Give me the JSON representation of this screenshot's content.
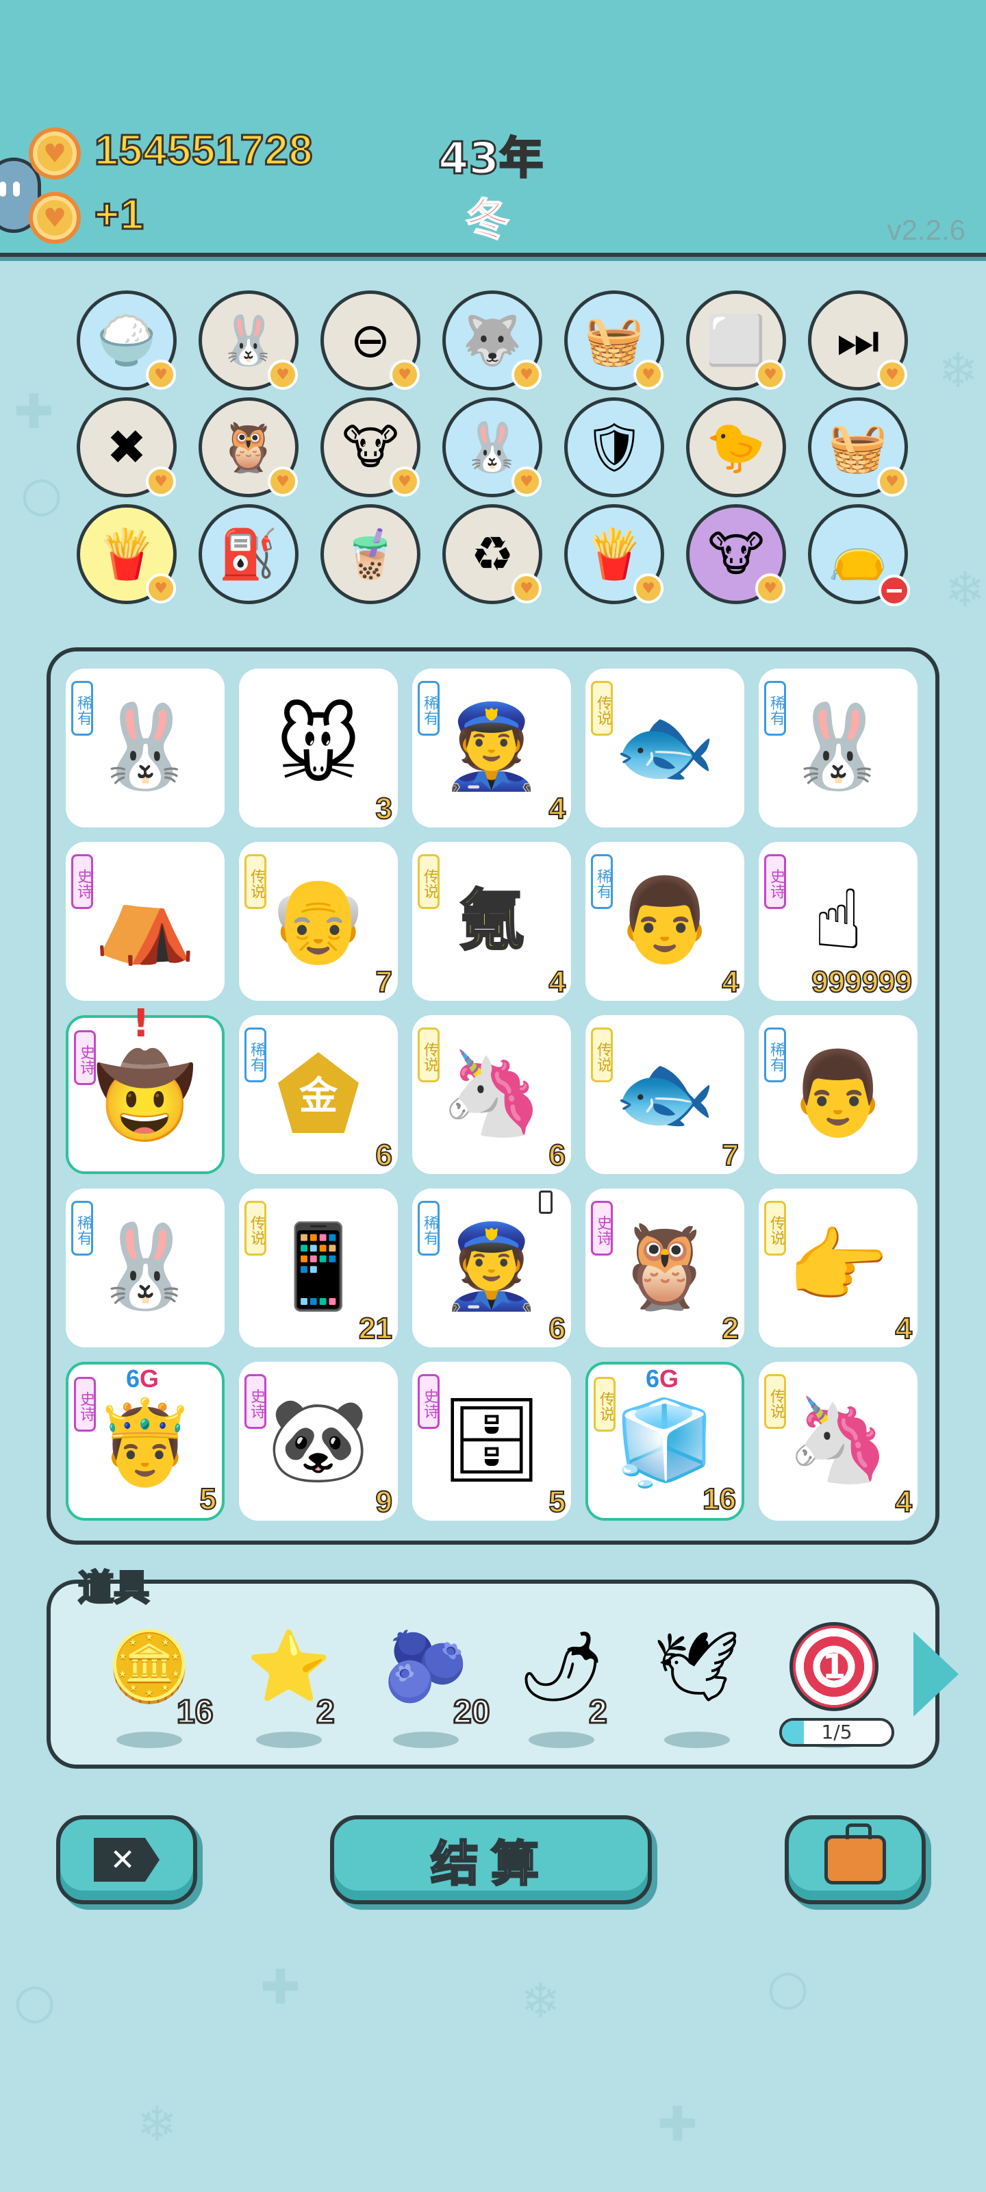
{
  "header": {
    "coins": "154551728",
    "coin_gain": "+1",
    "year": "43年",
    "season": "冬",
    "version": "v2.2.6"
  },
  "skills": [
    {
      "icon": "rice-bowl",
      "bg": "#bfe7f7",
      "badge": "heart"
    },
    {
      "icon": "rabbit",
      "bg": "#e9e4da",
      "badge": "heart"
    },
    {
      "icon": "minus-circle",
      "bg": "#e9e4da",
      "badge": "heart"
    },
    {
      "icon": "husky-dog",
      "bg": "#bfe7f7",
      "badge": "heart"
    },
    {
      "icon": "fruit-basket",
      "bg": "#bfe7f7",
      "badge": "heart"
    },
    {
      "icon": "cubes",
      "bg": "#e9e4da",
      "badge": "heart"
    },
    {
      "icon": "skip-next",
      "bg": "#e9e4da",
      "badge": "heart"
    },
    {
      "icon": "delete-tag",
      "bg": "#e9e4da",
      "badge": "heart"
    },
    {
      "icon": "owls",
      "bg": "#e9e4da",
      "badge": "heart"
    },
    {
      "icon": "cow-pair",
      "bg": "#e9e4da",
      "badge": "heart"
    },
    {
      "icon": "rabbit",
      "bg": "#bfe7f7",
      "badge": "heart"
    },
    {
      "icon": "shield-wrench",
      "bg": "#bfe7f7",
      "badge": "none"
    },
    {
      "icon": "chick-egg",
      "bg": "#e9e4da",
      "badge": "none"
    },
    {
      "icon": "fruit-basket",
      "bg": "#bfe7f7",
      "badge": "heart"
    },
    {
      "icon": "fries",
      "bg": "#fdf59a",
      "badge": "heart"
    },
    {
      "icon": "pump",
      "bg": "#bfe7f7",
      "badge": "none"
    },
    {
      "icon": "bubble-tea",
      "bg": "#e9e4da",
      "badge": "none"
    },
    {
      "icon": "recycle",
      "bg": "#e9e4da",
      "badge": "heart"
    },
    {
      "icon": "fries",
      "bg": "#bfe7f7",
      "badge": "heart"
    },
    {
      "icon": "cow-pair",
      "bg": "#c9a2e6",
      "badge": "heart"
    },
    {
      "icon": "sack",
      "bg": "#bfe7f7",
      "badge": "minus"
    }
  ],
  "board": [
    {
      "tag": "稀有",
      "rarity": "rare",
      "icon": "rabbit",
      "count": ""
    },
    {
      "tag": "",
      "rarity": "",
      "icon": "mouse",
      "count": "3"
    },
    {
      "tag": "稀有",
      "rarity": "rare",
      "icon": "police-officer",
      "count": "4"
    },
    {
      "tag": "传说",
      "rarity": "legend",
      "icon": "koi-fish",
      "count": ""
    },
    {
      "tag": "稀有",
      "rarity": "rare",
      "icon": "rabbit",
      "count": ""
    },
    {
      "tag": "史诗",
      "rarity": "epic",
      "icon": "rabbit-tent",
      "count": ""
    },
    {
      "tag": "传说",
      "rarity": "legend",
      "icon": "grinning-old-man",
      "count": "7"
    },
    {
      "tag": "传说",
      "rarity": "legend",
      "icon": "krypton-text",
      "text": "氪",
      "count": "4"
    },
    {
      "tag": "稀有",
      "rarity": "rare",
      "icon": "bald-man",
      "count": "4"
    },
    {
      "tag": "史诗",
      "rarity": "epic",
      "icon": "pointing-hand",
      "count": "999999"
    },
    {
      "tag": "史诗",
      "rarity": "epic",
      "icon": "cowboy-grandpa",
      "count": "",
      "highlight": true
    },
    {
      "tag": "稀有",
      "rarity": "rare",
      "icon": "gold-pentagon",
      "text": "金",
      "count": "6"
    },
    {
      "tag": "传说",
      "rarity": "legend",
      "icon": "unicorn",
      "count": "6"
    },
    {
      "tag": "传说",
      "rarity": "legend",
      "icon": "koi-fish",
      "count": "7"
    },
    {
      "tag": "稀有",
      "rarity": "rare",
      "icon": "bald-man",
      "count": ""
    },
    {
      "tag": "稀有",
      "rarity": "rare",
      "icon": "rabbit",
      "count": ""
    },
    {
      "tag": "传说",
      "rarity": "legend",
      "icon": "smartphone",
      "count": "21"
    },
    {
      "tag": "稀有",
      "rarity": "rare",
      "icon": "police-officer",
      "count": "6"
    },
    {
      "tag": "史诗",
      "rarity": "epic",
      "icon": "gray-hair-bird",
      "count": "2"
    },
    {
      "tag": "传说",
      "rarity": "legend",
      "icon": "golden-hand",
      "count": "4"
    },
    {
      "tag": "史诗",
      "rarity": "epic",
      "icon": "king-grandpa",
      "count": "5",
      "highlight": true,
      "sixg": "6G"
    },
    {
      "tag": "史诗",
      "rarity": "epic",
      "icon": "panda",
      "count": "9"
    },
    {
      "tag": "史诗",
      "rarity": "epic",
      "icon": "server-rack",
      "count": "5"
    },
    {
      "tag": "传说",
      "rarity": "legend",
      "icon": "fridge",
      "count": "16",
      "highlight": true,
      "sixg": "6G"
    },
    {
      "tag": "传说",
      "rarity": "legend",
      "icon": "unicorn",
      "count": "4"
    }
  ],
  "alert_mark": "!",
  "props": {
    "label": "道具",
    "items": [
      {
        "icon": "dollar-coin",
        "count": "16"
      },
      {
        "icon": "star",
        "count": "2"
      },
      {
        "icon": "blueberry",
        "count": "20"
      },
      {
        "icon": "chili-pepper",
        "count": "2"
      },
      {
        "icon": "pigeon",
        "count": ""
      },
      {
        "icon": "target-1",
        "count": ""
      }
    ],
    "target_digit": "1",
    "progress_text": "1/5",
    "progress_fraction": 0.2
  },
  "buttons": {
    "delete_label": "✕",
    "settle_label": "结算"
  },
  "colors": {
    "header_bg": "#6ec9cc",
    "page_bg": "#b6dfe6",
    "gold_text": "#ffd33d",
    "rare": "#3d9be0",
    "legend": "#e7c73a",
    "epic": "#c446c8",
    "highlight": "#2ec29a"
  }
}
